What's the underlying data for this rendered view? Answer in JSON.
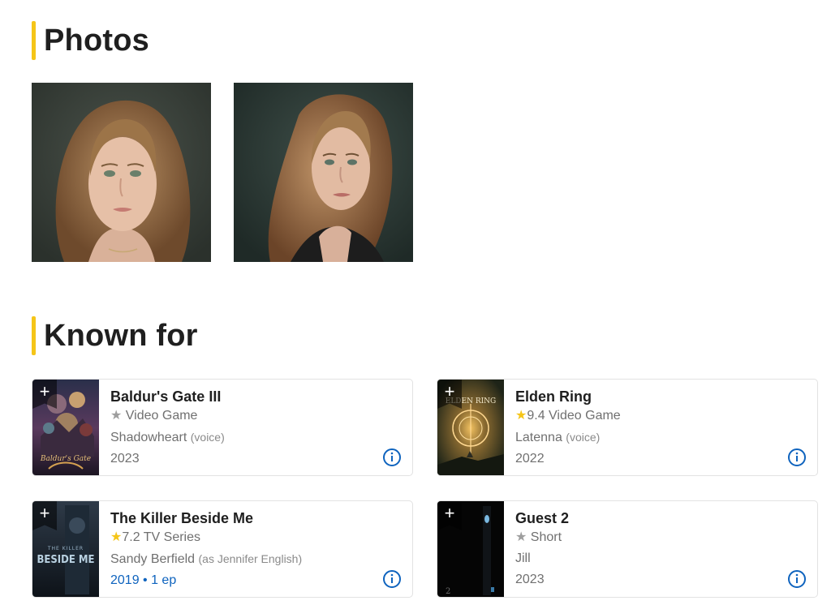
{
  "photos": {
    "title": "Photos"
  },
  "known_for": {
    "title": "Known for",
    "items": [
      {
        "title": "Baldur's Gate III",
        "rating": "",
        "type": "Video Game",
        "role": "Shadowheart",
        "role_note": "(voice)",
        "year": "2023",
        "poster_logo": "Baldur's Gate"
      },
      {
        "title": "Elden Ring",
        "rating": "9.4",
        "type": "Video Game",
        "role": "Latenna",
        "role_note": "(voice)",
        "year": "2022",
        "poster_logo": "ELDEN RING"
      },
      {
        "title": "The Killer Beside Me",
        "rating": "7.2",
        "type": "TV Series",
        "role": "Sandy Berfield",
        "role_note": "(as Jennifer English)",
        "year": "2019 • 1 ep",
        "poster_logo": "BESIDE ME",
        "poster_small": "THE KILLER"
      },
      {
        "title": "Guest 2",
        "rating": "",
        "type": "Short",
        "role": "Jill",
        "role_note": "",
        "year": "2023",
        "poster_logo": "2"
      }
    ]
  },
  "colors": {
    "accent": "#f5c518",
    "link": "#0e63be",
    "muted": "#707070"
  },
  "icons": {
    "add": "+",
    "star": "★",
    "info": "info-circle-icon"
  }
}
